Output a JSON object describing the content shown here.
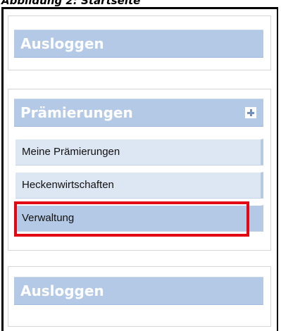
{
  "caption": "Abbildung 2: Startseite",
  "sections": {
    "top": {
      "header": "Ausloggen"
    },
    "middle": {
      "header": "Prämierungen",
      "expand_icon": "plus-icon",
      "items": [
        {
          "label": "Meine Prämierungen"
        },
        {
          "label": "Heckenwirtschaften"
        },
        {
          "label": "Verwaltung",
          "highlighted": true
        }
      ]
    },
    "bottom": {
      "header": "Ausloggen"
    }
  },
  "colors": {
    "header_bar": "#b4c9e6",
    "menu_item": "#dde6f3",
    "highlight_border": "#e30613"
  }
}
